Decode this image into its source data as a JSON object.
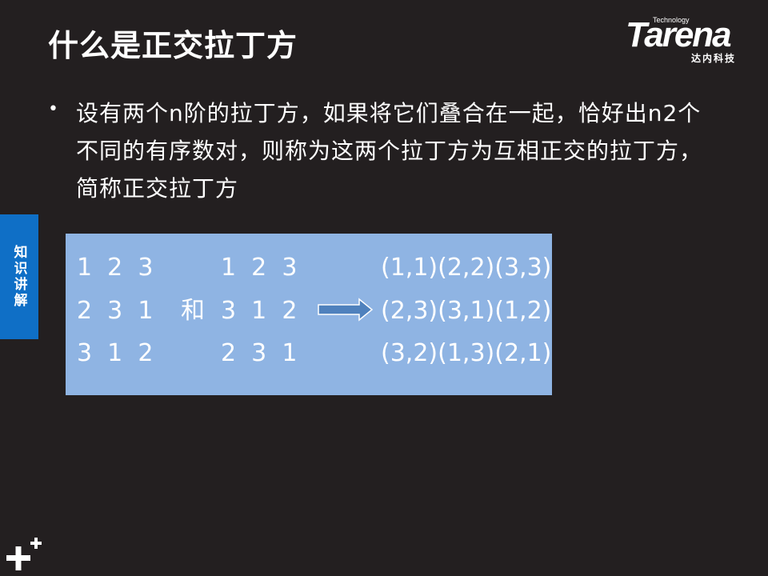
{
  "title": "什么是正交拉丁方",
  "logo": {
    "word": "Tarena",
    "tagline": "Technology",
    "cn": "达内科技"
  },
  "bullet": {
    "text": "设有两个n阶的拉丁方，如果将它们叠合在一起，恰好出n2个不同的有序数对，则称为这两个拉丁方为互相正交的拉丁方，简称正交拉丁方"
  },
  "side_tab": {
    "label": "知识讲解"
  },
  "example": {
    "square_a": [
      "1  2  3",
      "2  3  1",
      "3  1  2"
    ],
    "connector": "和",
    "square_b": [
      "1  2  3",
      "3  1  2",
      "2  3  1"
    ],
    "pairs": [
      "(1,1)(2,2)(3,3)",
      "(2,3)(3,1)(1,2)",
      "(3,2)(1,3)(2,1)"
    ]
  },
  "colors": {
    "background": "#231f20",
    "box": "#8fb4e3",
    "tab": "#0f6fc6",
    "arrow": "#4f81bd"
  },
  "icons": {
    "arrow": "right-arrow-icon",
    "corner": "plus-icon"
  }
}
